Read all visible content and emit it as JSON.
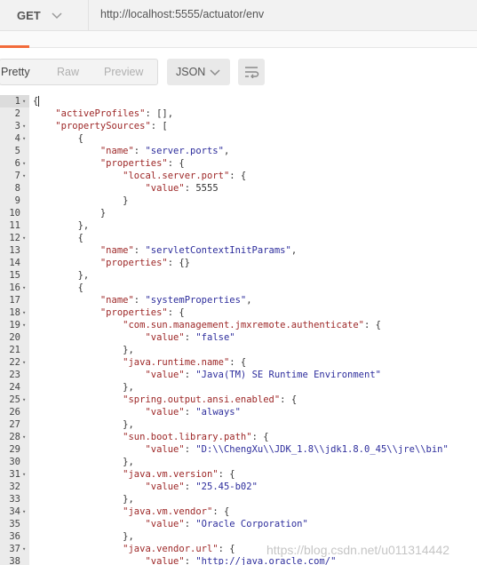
{
  "request": {
    "method": "GET",
    "url": "http://localhost:5555/actuator/env"
  },
  "toolbar": {
    "views": [
      "Pretty",
      "Raw",
      "Preview"
    ],
    "active_view": "Pretty",
    "format": "JSON",
    "wrap_icon": "wrap-lines-icon"
  },
  "colors": {
    "key": "#9d2727",
    "string": "#2d2d9c",
    "accent": "#f26b3a"
  },
  "lines": [
    {
      "n": "1",
      "f": true,
      "t": [
        [
          "p",
          "{"
        ]
      ]
    },
    {
      "n": "2",
      "f": false,
      "t": [
        [
          "p",
          "    "
        ],
        [
          "k",
          "\"activeProfiles\""
        ],
        [
          "p",
          ": [],"
        ]
      ]
    },
    {
      "n": "3",
      "f": true,
      "t": [
        [
          "p",
          "    "
        ],
        [
          "k",
          "\"propertySources\""
        ],
        [
          "p",
          ": ["
        ]
      ]
    },
    {
      "n": "4",
      "f": true,
      "t": [
        [
          "p",
          "        {"
        ]
      ]
    },
    {
      "n": "5",
      "f": false,
      "t": [
        [
          "p",
          "            "
        ],
        [
          "k",
          "\"name\""
        ],
        [
          "p",
          ": "
        ],
        [
          "s",
          "\"server.ports\""
        ],
        [
          "p",
          ","
        ]
      ]
    },
    {
      "n": "6",
      "f": true,
      "t": [
        [
          "p",
          "            "
        ],
        [
          "k",
          "\"properties\""
        ],
        [
          "p",
          ": {"
        ]
      ]
    },
    {
      "n": "7",
      "f": true,
      "t": [
        [
          "p",
          "                "
        ],
        [
          "k",
          "\"local.server.port\""
        ],
        [
          "p",
          ": {"
        ]
      ]
    },
    {
      "n": "8",
      "f": false,
      "t": [
        [
          "p",
          "                    "
        ],
        [
          "k",
          "\"value\""
        ],
        [
          "p",
          ": "
        ],
        [
          "n",
          "5555"
        ]
      ]
    },
    {
      "n": "9",
      "f": false,
      "t": [
        [
          "p",
          "                }"
        ]
      ]
    },
    {
      "n": "10",
      "f": false,
      "t": [
        [
          "p",
          "            }"
        ]
      ]
    },
    {
      "n": "11",
      "f": false,
      "t": [
        [
          "p",
          "        },"
        ]
      ]
    },
    {
      "n": "12",
      "f": true,
      "t": [
        [
          "p",
          "        {"
        ]
      ]
    },
    {
      "n": "13",
      "f": false,
      "t": [
        [
          "p",
          "            "
        ],
        [
          "k",
          "\"name\""
        ],
        [
          "p",
          ": "
        ],
        [
          "s",
          "\"servletContextInitParams\""
        ],
        [
          "p",
          ","
        ]
      ]
    },
    {
      "n": "14",
      "f": false,
      "t": [
        [
          "p",
          "            "
        ],
        [
          "k",
          "\"properties\""
        ],
        [
          "p",
          ": {}"
        ]
      ]
    },
    {
      "n": "15",
      "f": false,
      "t": [
        [
          "p",
          "        },"
        ]
      ]
    },
    {
      "n": "16",
      "f": true,
      "t": [
        [
          "p",
          "        {"
        ]
      ]
    },
    {
      "n": "17",
      "f": false,
      "t": [
        [
          "p",
          "            "
        ],
        [
          "k",
          "\"name\""
        ],
        [
          "p",
          ": "
        ],
        [
          "s",
          "\"systemProperties\""
        ],
        [
          "p",
          ","
        ]
      ]
    },
    {
      "n": "18",
      "f": true,
      "t": [
        [
          "p",
          "            "
        ],
        [
          "k",
          "\"properties\""
        ],
        [
          "p",
          ": {"
        ]
      ]
    },
    {
      "n": "19",
      "f": true,
      "t": [
        [
          "p",
          "                "
        ],
        [
          "k",
          "\"com.sun.management.jmxremote.authenticate\""
        ],
        [
          "p",
          ": {"
        ]
      ]
    },
    {
      "n": "20",
      "f": false,
      "t": [
        [
          "p",
          "                    "
        ],
        [
          "k",
          "\"value\""
        ],
        [
          "p",
          ": "
        ],
        [
          "s",
          "\"false\""
        ]
      ]
    },
    {
      "n": "21",
      "f": false,
      "t": [
        [
          "p",
          "                },"
        ]
      ]
    },
    {
      "n": "22",
      "f": true,
      "t": [
        [
          "p",
          "                "
        ],
        [
          "k",
          "\"java.runtime.name\""
        ],
        [
          "p",
          ": {"
        ]
      ]
    },
    {
      "n": "23",
      "f": false,
      "t": [
        [
          "p",
          "                    "
        ],
        [
          "k",
          "\"value\""
        ],
        [
          "p",
          ": "
        ],
        [
          "s",
          "\"Java(TM) SE Runtime Environment\""
        ]
      ]
    },
    {
      "n": "24",
      "f": false,
      "t": [
        [
          "p",
          "                },"
        ]
      ]
    },
    {
      "n": "25",
      "f": true,
      "t": [
        [
          "p",
          "                "
        ],
        [
          "k",
          "\"spring.output.ansi.enabled\""
        ],
        [
          "p",
          ": {"
        ]
      ]
    },
    {
      "n": "26",
      "f": false,
      "t": [
        [
          "p",
          "                    "
        ],
        [
          "k",
          "\"value\""
        ],
        [
          "p",
          ": "
        ],
        [
          "s",
          "\"always\""
        ]
      ]
    },
    {
      "n": "27",
      "f": false,
      "t": [
        [
          "p",
          "                },"
        ]
      ]
    },
    {
      "n": "28",
      "f": true,
      "t": [
        [
          "p",
          "                "
        ],
        [
          "k",
          "\"sun.boot.library.path\""
        ],
        [
          "p",
          ": {"
        ]
      ]
    },
    {
      "n": "29",
      "f": false,
      "t": [
        [
          "p",
          "                    "
        ],
        [
          "k",
          "\"value\""
        ],
        [
          "p",
          ": "
        ],
        [
          "s",
          "\"D:\\\\ChengXu\\\\JDK_1.8\\\\jdk1.8.0_45\\\\jre\\\\bin\""
        ]
      ]
    },
    {
      "n": "30",
      "f": false,
      "t": [
        [
          "p",
          "                },"
        ]
      ]
    },
    {
      "n": "31",
      "f": true,
      "t": [
        [
          "p",
          "                "
        ],
        [
          "k",
          "\"java.vm.version\""
        ],
        [
          "p",
          ": {"
        ]
      ]
    },
    {
      "n": "32",
      "f": false,
      "t": [
        [
          "p",
          "                    "
        ],
        [
          "k",
          "\"value\""
        ],
        [
          "p",
          ": "
        ],
        [
          "s",
          "\"25.45-b02\""
        ]
      ]
    },
    {
      "n": "33",
      "f": false,
      "t": [
        [
          "p",
          "                },"
        ]
      ]
    },
    {
      "n": "34",
      "f": true,
      "t": [
        [
          "p",
          "                "
        ],
        [
          "k",
          "\"java.vm.vendor\""
        ],
        [
          "p",
          ": {"
        ]
      ]
    },
    {
      "n": "35",
      "f": false,
      "t": [
        [
          "p",
          "                    "
        ],
        [
          "k",
          "\"value\""
        ],
        [
          "p",
          ": "
        ],
        [
          "s",
          "\"Oracle Corporation\""
        ]
      ]
    },
    {
      "n": "36",
      "f": false,
      "t": [
        [
          "p",
          "                },"
        ]
      ]
    },
    {
      "n": "37",
      "f": true,
      "t": [
        [
          "p",
          "                "
        ],
        [
          "k",
          "\"java.vendor.url\""
        ],
        [
          "p",
          ": {"
        ]
      ]
    },
    {
      "n": "38",
      "f": false,
      "t": [
        [
          "p",
          "                    "
        ],
        [
          "k",
          "\"value\""
        ],
        [
          "p",
          ": "
        ],
        [
          "s",
          "\"http://java.oracle.com/\""
        ]
      ]
    }
  ],
  "watermark": "https://blog.csdn.net/u011314442"
}
